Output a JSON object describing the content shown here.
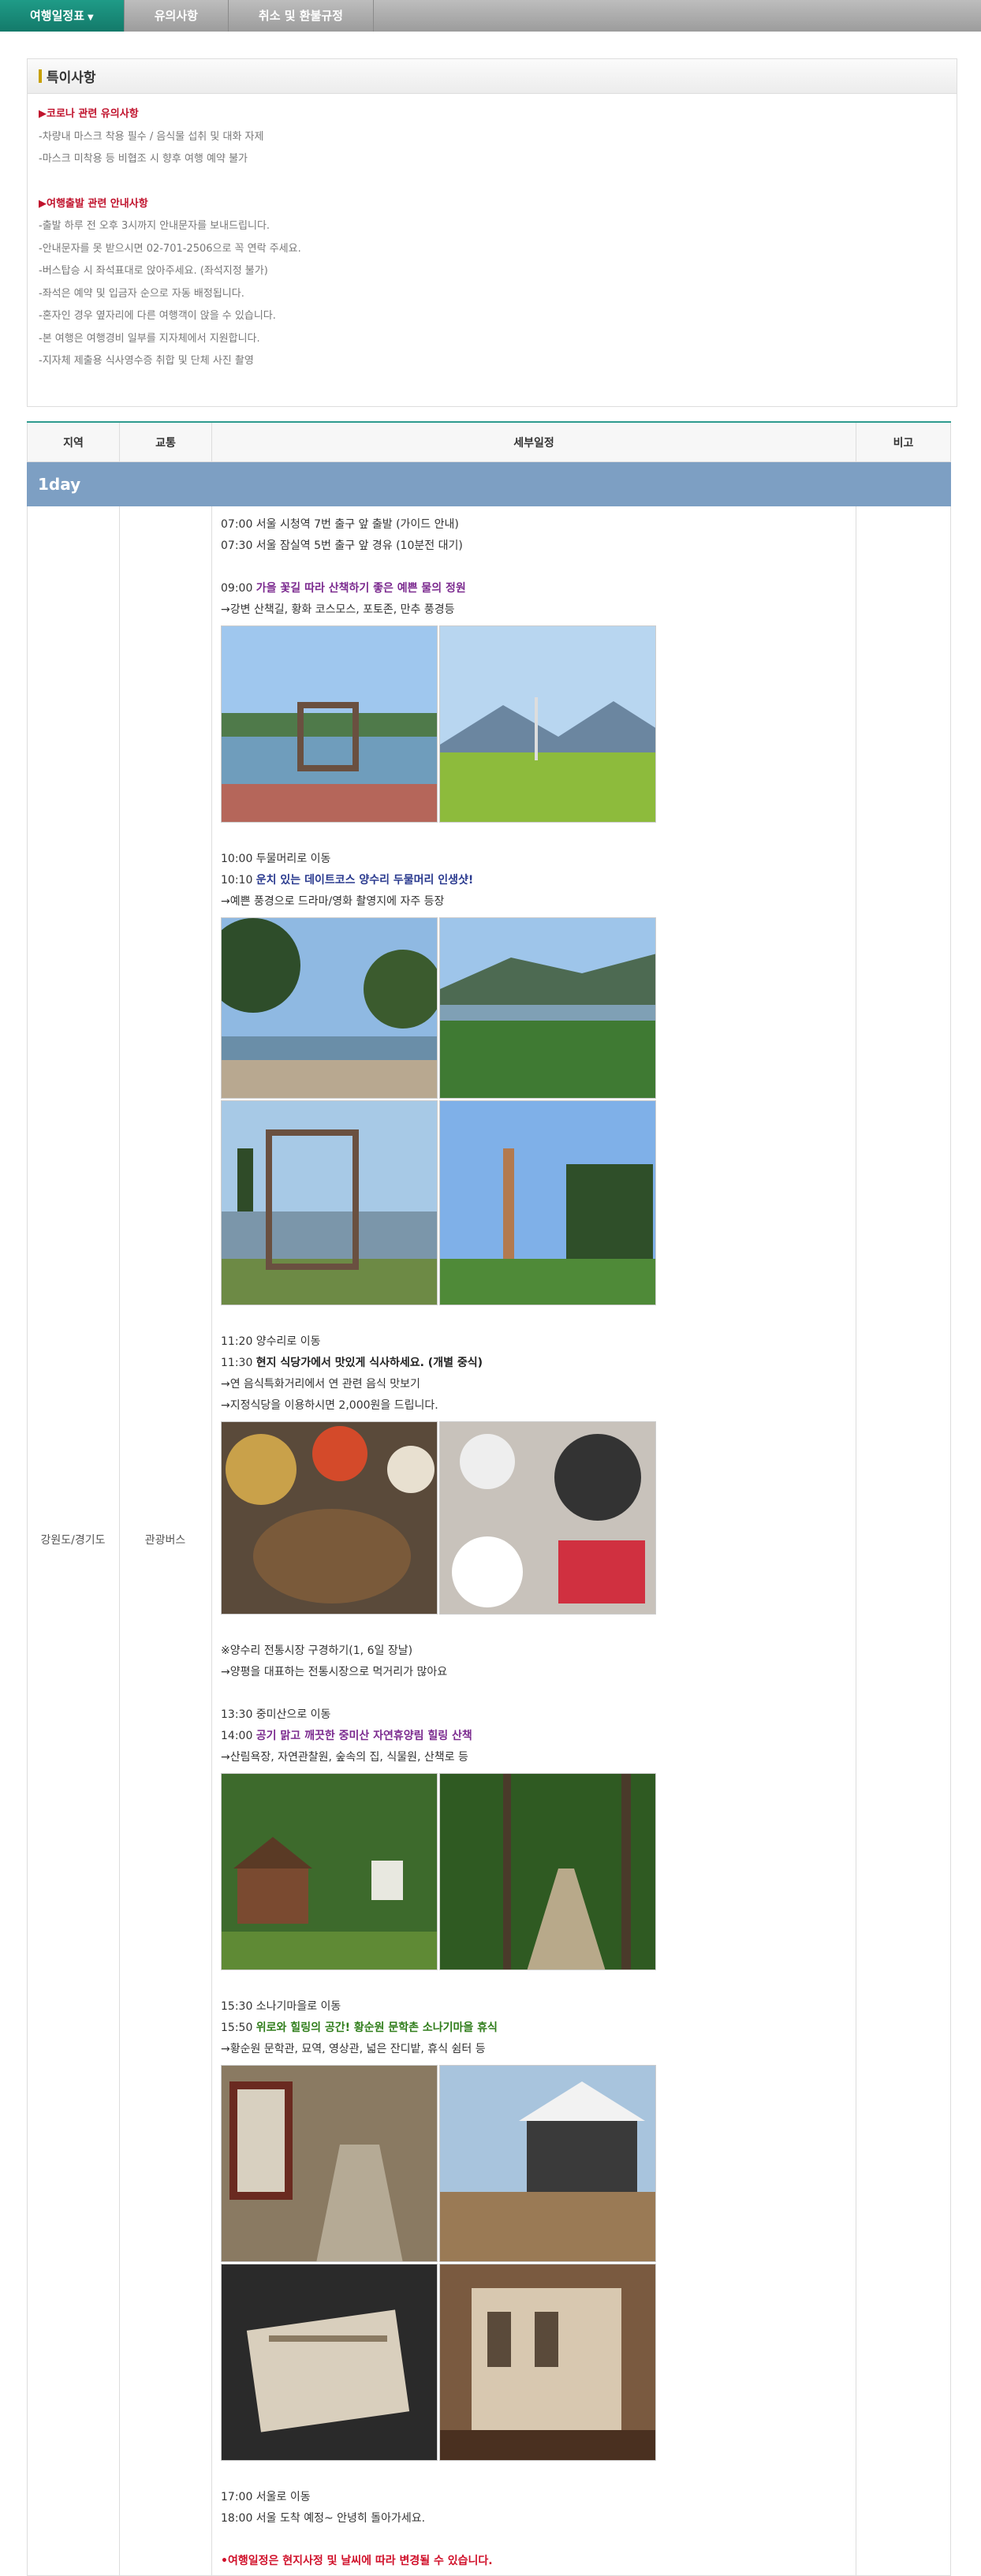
{
  "tabs": [
    {
      "label": "여행일정표"
    },
    {
      "label": "유의사항"
    },
    {
      "label": "취소 및 환불규정"
    }
  ],
  "notice": {
    "title": "특이사항",
    "section1_title": "▶코로나 관련 유의사항",
    "section1_lines": [
      "-차량내 마스크 착용 필수 / 음식물 섭취 및 대화 자제",
      "-마스크 미착용 등 비협조 시 향후 여행 예약 불가"
    ],
    "section2_title": "▶여행출발 관련 안내사항",
    "section2_lines": [
      "-출발 하루 전 오후 3시까지 안내문자를 보내드립니다.",
      "-안내문자를 못 받으시면 02-701-2506으로 꼭 연락 주세요.",
      "-버스탑승 시 좌석표대로 앉아주세요. (좌석지정 불가)",
      "-좌석은 예약 및 입금자 순으로 자동 배정됩니다.",
      "-혼자인 경우 옆자리에 다른 여행객이 앉을 수 있습니다.",
      "-본 여행은 여행경비 일부를 지자체에서 지원합니다.",
      "-지자체 제출용 식사영수증 취합 및 단체 사진 촬영"
    ]
  },
  "table": {
    "headers": {
      "region": "지역",
      "transport": "교통",
      "detail": "세부일정",
      "note": "비고"
    },
    "day_label": "1day",
    "region": "강원도/경기도",
    "transport": "관광버스",
    "schedule": {
      "l1": "07:00 서울 시청역 7번 출구 앞 출발 (가이드 안내)",
      "l2": "07:30 서울 잠실역 5번 출구 앞 경유 (10분전 대기)",
      "l3_time": " 09:00 ",
      "l3_title": "가을 꽃길 따라 산책하기 좋은 예쁜 물의 정원",
      "l4": "→강변 산책길, 황화 코스모스, 포토존, 만추 풍경등",
      "l5": "10:00 두물머리로 이동",
      "l6_time": "10:10 ",
      "l6_title": "운치 있는 데이트코스 양수리 두물머리 인생샷!",
      "l7": "→예쁜 풍경으로 드라마/영화 촬영지에 자주 등장",
      "l8": "11:20 양수리로 이동",
      "l9_time": "11:30 ",
      "l9_title": "현지 식당가에서 맛있게 식사하세요. (개별 중식)",
      "l10": "→연 음식특화거리에서 연 관련 음식 맛보기",
      "l11": "→지정식당을 이용하시면 2,000원을 드립니다.",
      "l12": "※양수리 전통시장 구경하기(1, 6일 장날)",
      "l13": "→양평을 대표하는 전통시장으로 먹거리가 많아요",
      "l14": "13:30 중미산으로 이동",
      "l15_time": "14:00 ",
      "l15_title": "공기 맑고 깨끗한 중미산 자연휴양림 힐링 산책",
      "l16": "→산림욕장, 자연관찰원, 숲속의 집, 식물원, 산책로 등",
      "l17": "15:30 소나기마을로 이동",
      "l18_time": "15:50 ",
      "l18_title": "위로와 힐링의 공간! 황순원 문학촌 소나기마을 휴식",
      "l19": "→황순원 문학관, 묘역, 영상관, 넓은 잔디밭, 휴식 쉼터 등",
      "l20": "17:00 서울로 이동",
      "l21": "18:00 서울 도착 예정~ 안녕히 돌아가세요.",
      "l22": "•여행일정은 현지사정 및 날씨에 따라 변경될 수 있습니다."
    }
  },
  "colors": {
    "tab_active": "#1a8d7a",
    "day_bar": "#7d9fc3",
    "accent_red": "#c0122c"
  }
}
